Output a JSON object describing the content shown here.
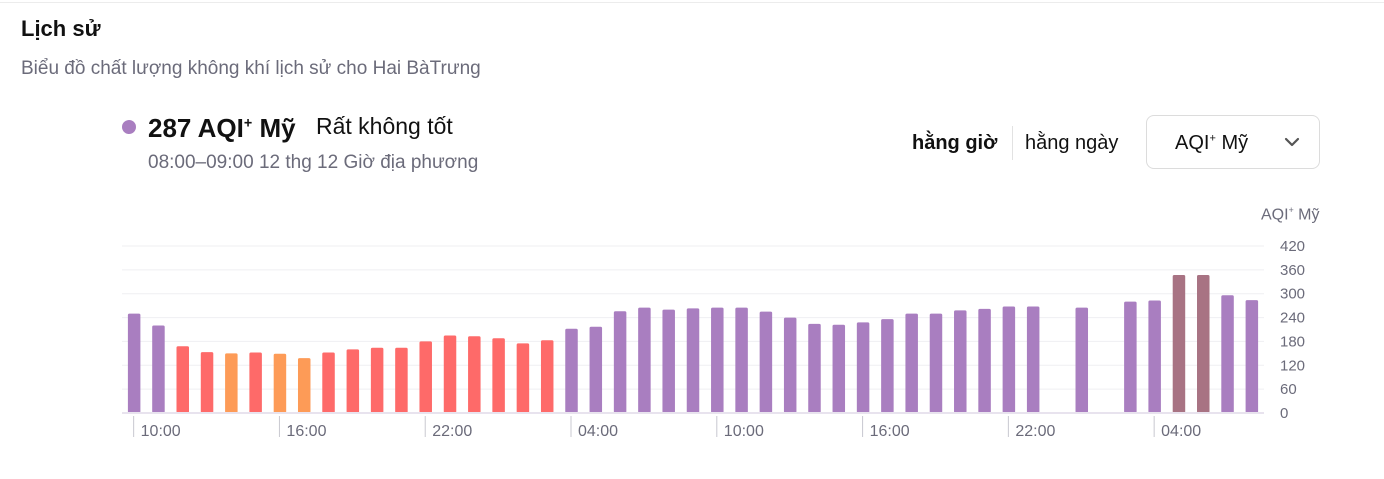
{
  "header": {
    "title": "Lịch sử",
    "subtitle": "Biểu đồ chất lượng không khí lịch sử cho Hai BàTrưng"
  },
  "current": {
    "value": "287",
    "unit_main": "AQI",
    "unit_sup": "+",
    "unit_suffix": " Mỹ",
    "status": "Rất không tốt",
    "time": "08:00–09:00 12 thg 12 Giờ địa phương",
    "dot_color": "#a97ec0"
  },
  "controls": {
    "hourly_label": "hằng giờ",
    "daily_label": "hằng ngày",
    "unit_select": {
      "main": "AQI",
      "sup": "+",
      "suffix": " Mỹ"
    }
  },
  "chart_data": {
    "type": "bar",
    "y_unit": {
      "main": "AQI",
      "sup": "+",
      "suffix": " Mỹ"
    },
    "ylim": [
      0,
      420
    ],
    "yticks": [
      0,
      60,
      120,
      180,
      240,
      300,
      360,
      420
    ],
    "grid": true,
    "x_tick_labels": [
      "10:00",
      "16:00",
      "22:00",
      "04:00",
      "10:00",
      "16:00",
      "22:00",
      "04:00"
    ],
    "x_tick_bar_index": [
      0,
      6,
      12,
      18,
      24,
      30,
      36,
      42
    ],
    "values": [
      250,
      220,
      168,
      153,
      150,
      152,
      149,
      138,
      152,
      160,
      164,
      164,
      180,
      195,
      193,
      188,
      175,
      183,
      212,
      217,
      256,
      265,
      260,
      263,
      265,
      265,
      255,
      240,
      224,
      222,
      228,
      236,
      250,
      250,
      258,
      262,
      268,
      268,
      null,
      265,
      null,
      280,
      283,
      347,
      347,
      296,
      284
    ],
    "colors": {
      "very_unhealthy": "#a97ec0",
      "unhealthy": "#fe6a69",
      "unhealthy_sensitive": "#fd9b57",
      "hazardous": "#a87383"
    }
  }
}
